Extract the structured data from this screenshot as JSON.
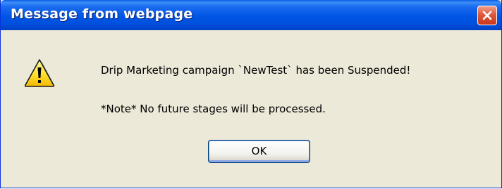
{
  "window": {
    "title": "Message from webpage",
    "close_icon": "close-icon",
    "title_color": "#ffffff",
    "titlebar_color": "#0055e5"
  },
  "dialog": {
    "icon": "warning-icon",
    "message": "Drip Marketing campaign `NewTest` has been Suspended!",
    "note": "*Note* No future stages will be processed.",
    "ok_label": "OK"
  }
}
